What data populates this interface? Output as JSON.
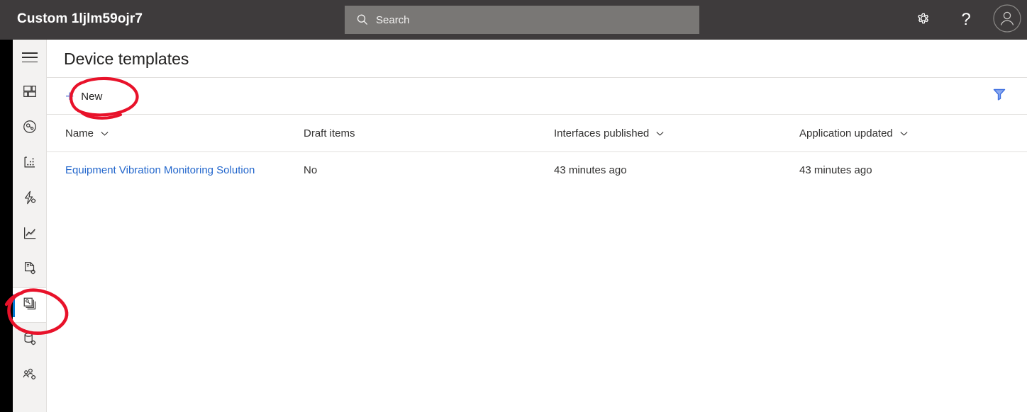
{
  "header": {
    "app_title": "Custom 1ljlm59ojr7",
    "search": {
      "placeholder": "Search",
      "value": "",
      "icon": "search-icon"
    },
    "settings_icon": "gear-icon",
    "help_icon": "question-mark-icon",
    "help_glyph": "?",
    "avatar_icon": "user-avatar-icon",
    "background_color": "#3e3b3c",
    "search_background_color": "#797775"
  },
  "sidebar": {
    "menu_toggle": {
      "icon": "hamburger-menu-icon"
    },
    "background_color": "#f3f2f1",
    "selected_indicator_color": "#0078d4",
    "items": [
      {
        "icon": "dashboard-grid-icon",
        "name": "dashboard",
        "selected": false
      },
      {
        "icon": "devices-circle-icon",
        "name": "devices",
        "selected": false
      },
      {
        "icon": "device-groups-icon",
        "name": "device-groups",
        "selected": false
      },
      {
        "icon": "rules-lightning-icon",
        "name": "rules",
        "selected": false
      },
      {
        "icon": "analytics-chart-icon",
        "name": "analytics",
        "selected": false
      },
      {
        "icon": "jobs-document-icon",
        "name": "jobs",
        "selected": false
      },
      {
        "icon": "device-templates-icon",
        "name": "device-templates",
        "selected": true
      },
      {
        "icon": "data-export-icon",
        "name": "data-export",
        "selected": false
      },
      {
        "icon": "administration-icon",
        "name": "administration",
        "selected": false
      }
    ]
  },
  "main": {
    "page_title": "Device templates",
    "command_bar": {
      "new_label": "New",
      "new_icon": "plus-icon",
      "plus_color": "#6b8ce0",
      "filter_icon": "filter-funnel-icon",
      "filter_color": "#3f6fe0"
    },
    "table": {
      "columns": [
        {
          "label": "Name",
          "sortable": true
        },
        {
          "label": "Draft items",
          "sortable": false
        },
        {
          "label": "Interfaces published",
          "sortable": true
        },
        {
          "label": "Application updated",
          "sortable": true
        }
      ],
      "rows": [
        {
          "name": "Equipment Vibration Monitoring Solution",
          "draft_items": "No",
          "interfaces_published": "43 minutes ago",
          "application_updated": "43 minutes ago"
        }
      ],
      "link_color": "#2266cc"
    }
  },
  "annotations": {
    "color": "#e8122a",
    "shapes": [
      {
        "name": "new-button-highlight",
        "target": "new-button"
      },
      {
        "name": "sidebar-item-highlight",
        "target": "device-templates-rail-item"
      }
    ]
  }
}
